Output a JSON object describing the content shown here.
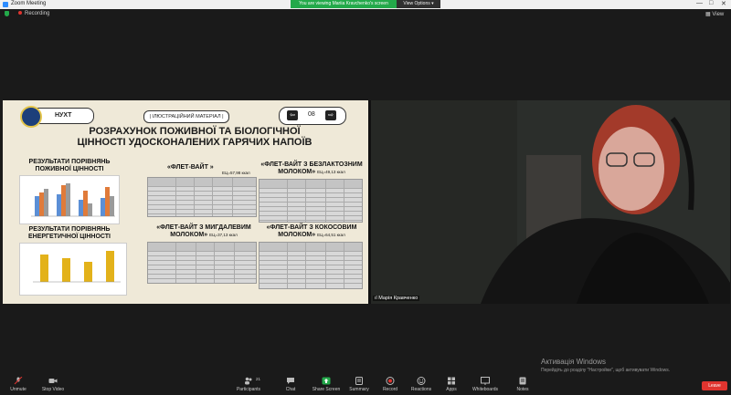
{
  "window": {
    "app_title": "Zoom Meeting"
  },
  "banner": {
    "text": "You are viewing Mariia Kravchenko's screen",
    "view_options": "View Options"
  },
  "top": {
    "recording": "Recording",
    "view": "View"
  },
  "slide": {
    "header_left": "НУХТ",
    "header_middle": "| ІЛЮСТРАЦІЙНИЙ МАТЕРІАЛ |",
    "page_number": "08",
    "prev_arrow": "⇦",
    "next_arrow": "⇨",
    "title_line1": "РОЗРАХУНОК ПОЖИВНОЇ ТА БІОЛОГІЧНОЇ",
    "title_line2": "ЦІННОСТІ УДОСКОНАЛЕНИХ ГАРЯЧИХ НАПОЇВ",
    "label1_line1": "РЕЗУЛЬТАТИ ПОРІВНЯНЬ",
    "label1_line2": "ПОЖИВНОЇ ЦІННОСТІ",
    "label2_line1": "РЕЗУЛЬТАТИ ПОРІВНЯНЬ",
    "label2_line2": "ЕНЕРГЕТИЧНОЇ ЦІННОСТІ",
    "t1_title": "«ФЛЕТ-ВАЙТ »",
    "t1_energy": "ЕЦ=57,98 ккал",
    "t2_title_line1": "«ФЛЕТ-ВАЙТ З БЕЗЛАКТОЗНИМ",
    "t2_title_line2": "МОЛОКОМ»",
    "t2_energy": "ЕЦ=49,13 ккал",
    "t3_title_line1": "«ФЛЕТ-ВАЙТ З МИГДАЛЕВИМ",
    "t3_title_line2": "МОЛОКОМ»",
    "t3_energy": "ЕЦ=37,13 ккал",
    "t4_title_line1": "«ФЛЕТ-ВАЙТ З КОКОСОВИМ",
    "t4_title_line2": "МОЛОКОМ»",
    "t4_energy": "ЕЦ=64,51 ккал"
  },
  "video": {
    "participant_name": "Марія Кравченко"
  },
  "toolbar": {
    "unmute": "Unmute",
    "stop_video": "Stop Video",
    "participants": "Participants",
    "participants_count": "21",
    "chat": "Chat",
    "share_screen": "Share Screen",
    "summary": "Summary",
    "record": "Record",
    "reactions": "Reactions",
    "apps": "Apps",
    "whiteboards": "Whiteboards",
    "notes": "Notes",
    "leave": "Leave"
  },
  "windows_activation": {
    "title": "Активація Windows",
    "subtitle": "Перейдіть до розділу \"Настройки\", щоб активувати Windows."
  },
  "colors": {
    "accent_green": "#23a94a",
    "leave_red": "#e0342f",
    "chart_bar_orange": "#e07b3a",
    "chart_bar_blue": "#5b8fd6",
    "chart_bar_gray": "#9a9a9a",
    "chart_bar_yellow": "#e3b21a"
  }
}
